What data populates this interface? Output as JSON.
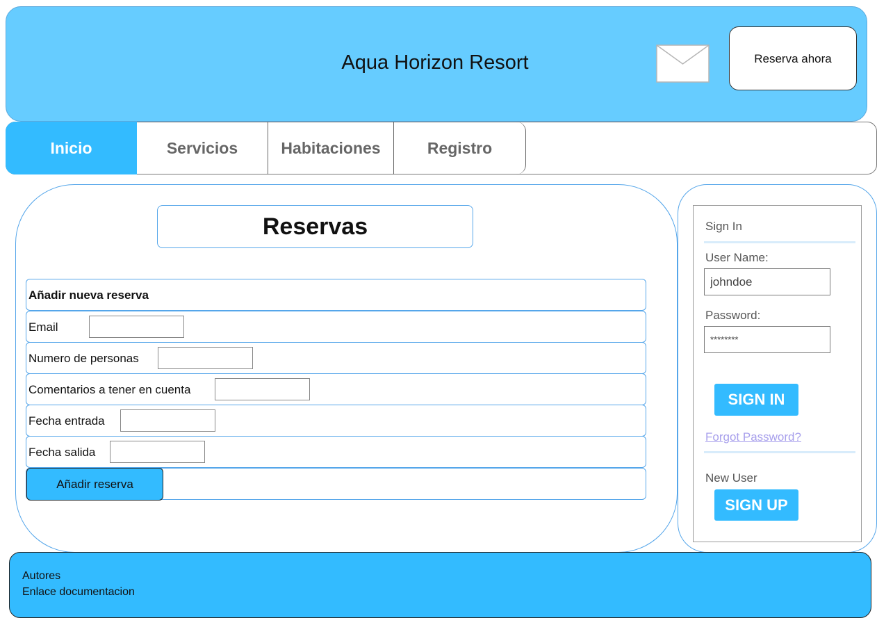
{
  "header": {
    "title": "Aqua Horizon Resort",
    "mail_icon": "envelope-icon",
    "reserve_button_label": "Reserva ahora"
  },
  "nav": {
    "tabs": [
      {
        "label": "Inicio",
        "active": true
      },
      {
        "label": "Servicios",
        "active": false
      },
      {
        "label": "Habitaciones",
        "active": false
      },
      {
        "label": "Registro",
        "active": false
      }
    ]
  },
  "main": {
    "title": "Reservas",
    "form": {
      "heading": "Añadir nueva reserva",
      "fields": [
        {
          "label": "Email",
          "value": ""
        },
        {
          "label": "Numero de personas",
          "value": ""
        },
        {
          "label": "Comentarios a tener en cuenta",
          "value": ""
        },
        {
          "label": "Fecha entrada",
          "value": ""
        },
        {
          "label": "Fecha salida",
          "value": ""
        }
      ],
      "submit_label": "Añadir reserva"
    }
  },
  "sidebar": {
    "sign_in_heading": "Sign In",
    "username_label": "User Name:",
    "username_value": "johndoe",
    "password_label": "Password:",
    "password_value": "********",
    "sign_in_button": "SIGN IN",
    "forgot_password": "Forgot Password?",
    "new_user_label": "New User",
    "sign_up_button": "SIGN UP"
  },
  "footer": {
    "links": [
      "Autores",
      "Enlace documentacion"
    ]
  },
  "colors": {
    "header_bg": "#66ccff",
    "accent": "#33bbff",
    "panel_border": "#55a6ea"
  }
}
